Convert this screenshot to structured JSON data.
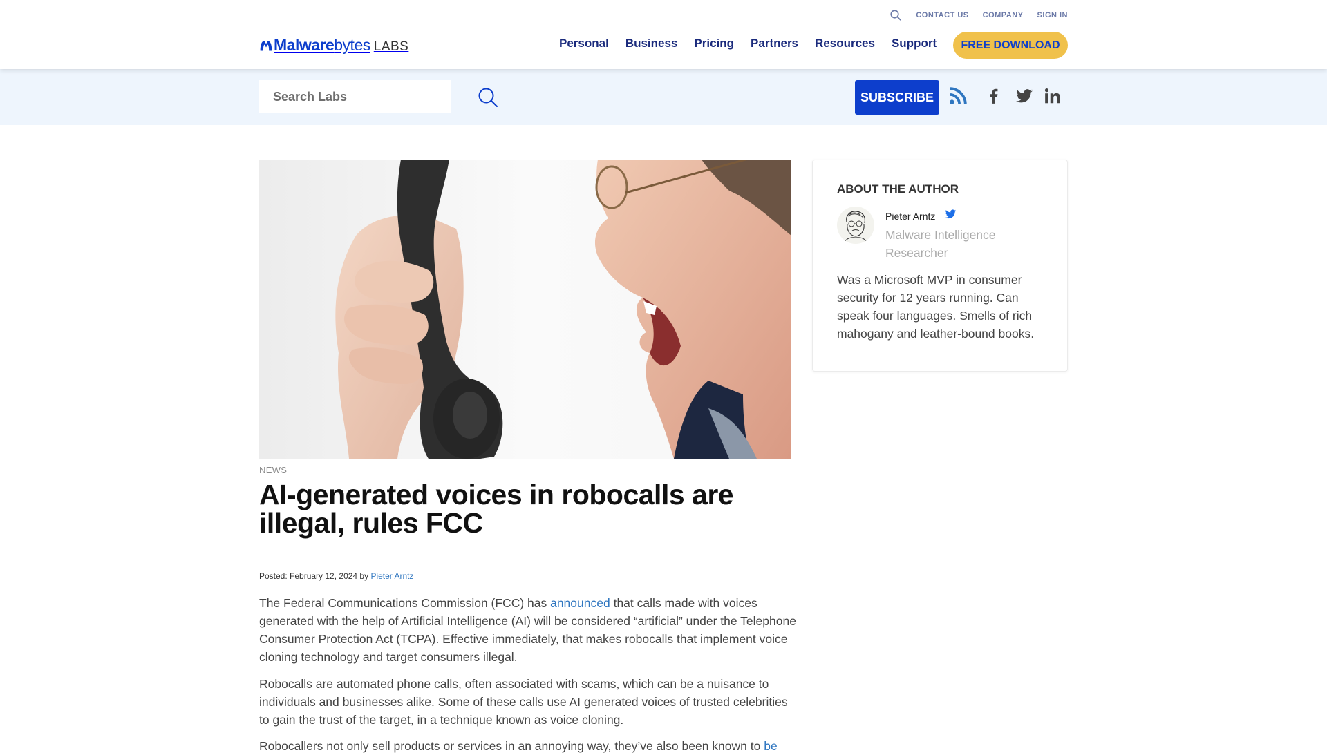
{
  "header": {
    "logo": {
      "brand_bold": "Malware",
      "brand_light": "bytes",
      "suffix": "LABS"
    },
    "utility_links": [
      "CONTACT US",
      "COMPANY",
      "SIGN IN"
    ],
    "nav": [
      "Personal",
      "Business",
      "Pricing",
      "Partners",
      "Resources",
      "Support"
    ],
    "download_label": "FREE DOWNLOAD"
  },
  "subbar": {
    "search_placeholder": "Search Labs",
    "subscribe_label": "SUBSCRIBE",
    "social": [
      "rss-icon",
      "facebook-icon",
      "twitter-icon",
      "linkedin-icon"
    ]
  },
  "article": {
    "hero_alt": "Man yelling into a black telephone handset",
    "category": "NEWS",
    "title": "AI-generated voices in robocalls are illegal, rules FCC",
    "posted_prefix": "Posted: February 12, 2024 by ",
    "author_link": "Pieter Arntz",
    "p1_before": "The Federal Communications Commission (FCC) has ",
    "p1_link": "announced",
    "p1_after": " that calls made with voices generated with the help of Artificial Intelligence (AI) will be considered “artificial” under the Telephone Consumer Protection Act (TCPA). Effective immediately, that makes robocalls that implement voice cloning technology and target consumers illegal.",
    "p2": "Robocalls are automated phone calls, often associated with scams, which can be a nuisance to individuals and businesses alike. Some of these calls use AI generated voices of trusted celebrities to gain the trust of the target, in a technique known as voice cloning.",
    "p3_before": "Robocallers not only sell products or services in an annoying way, they’ve also been known to ",
    "p3_link": "be"
  },
  "author_card": {
    "heading": "ABOUT THE AUTHOR",
    "name": "Pieter Arntz",
    "role": "Malware Intelligence Researcher",
    "bio": "Was a Microsoft MVP in consumer security for 12 years running. Can speak four languages. Smells of rich mahogany and leather-bound books."
  },
  "colors": {
    "brand_blue": "#0d3ecc",
    "nav_navy": "#1a2a7c",
    "download_yellow": "#f0c14b",
    "subbar_bg": "#eef5fd",
    "link_blue": "#2f76c0",
    "rss_blue": "#2f76c0"
  }
}
